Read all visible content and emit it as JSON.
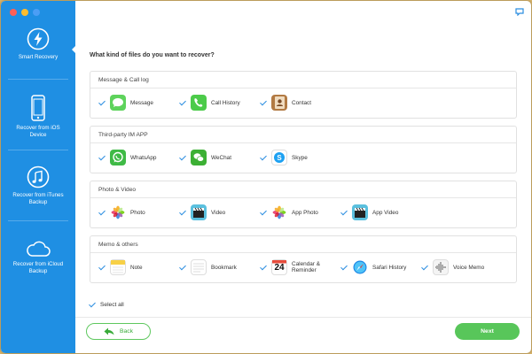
{
  "colors": {
    "sidebar": "#1f8fe3",
    "accent_green": "#58c65a",
    "check_blue": "#2a8de0"
  },
  "sidebar": {
    "items": [
      {
        "label": "Smart Recovery",
        "icon": "lightning-icon",
        "active": true
      },
      {
        "label": "Recover from iOS Device",
        "icon": "iphone-icon",
        "active": false
      },
      {
        "label": "Recover from iTunes Backup",
        "icon": "music-note-icon",
        "active": false
      },
      {
        "label": "Recover from iCloud Backup",
        "icon": "cloud-icon",
        "active": false
      }
    ]
  },
  "main": {
    "question": "What kind of files do you want to recover?",
    "groups": [
      {
        "title": "Message & Call log",
        "items": [
          {
            "label": "Message",
            "icon": "message-icon",
            "checked": true
          },
          {
            "label": "Call History",
            "icon": "phone-icon",
            "checked": true
          },
          {
            "label": "Contact",
            "icon": "contacts-icon",
            "checked": true
          }
        ]
      },
      {
        "title": "Third-party IM APP",
        "items": [
          {
            "label": "WhatsApp",
            "icon": "whatsapp-icon",
            "checked": true
          },
          {
            "label": "WeChat",
            "icon": "wechat-icon",
            "checked": true
          },
          {
            "label": "Skype",
            "icon": "skype-icon",
            "checked": true
          }
        ]
      },
      {
        "title": "Photo & Video",
        "items": [
          {
            "label": "Photo",
            "icon": "photos-icon",
            "checked": true
          },
          {
            "label": "Video",
            "icon": "clapperboard-icon",
            "checked": true
          },
          {
            "label": "App Photo",
            "icon": "photos-icon",
            "checked": true
          },
          {
            "label": "App Video",
            "icon": "clapperboard-icon",
            "checked": true
          }
        ]
      },
      {
        "title": "Memo & others",
        "items": [
          {
            "label": "Note",
            "icon": "notes-icon",
            "checked": true
          },
          {
            "label": "Bookmark",
            "icon": "bookmark-icon",
            "checked": true
          },
          {
            "label": "Calendar & Reminder",
            "icon": "calendar-icon",
            "calendar_day": "24",
            "checked": true
          },
          {
            "label": "Safari History",
            "icon": "safari-icon",
            "checked": true
          },
          {
            "label": "Voice Memo",
            "icon": "voice-memo-icon",
            "checked": true
          }
        ]
      }
    ],
    "select_all_label": "Select all",
    "select_all_checked": true
  },
  "footer": {
    "back_label": "Back",
    "next_label": "Next"
  }
}
